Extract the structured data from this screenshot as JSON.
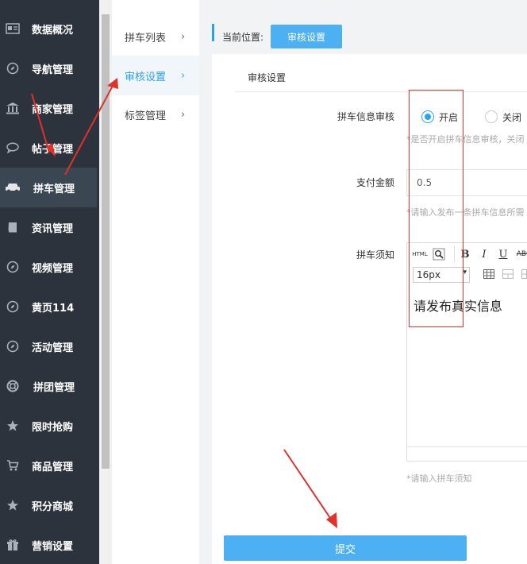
{
  "sidebar": {
    "items": [
      {
        "label": "数据概况",
        "icon": "dashboard-icon"
      },
      {
        "label": "导航管理",
        "icon": "compass-icon"
      },
      {
        "label": "商家管理",
        "icon": "bank-icon"
      },
      {
        "label": "帖子管理",
        "icon": "chat-icon"
      },
      {
        "label": "拼车管理",
        "icon": "car-icon"
      },
      {
        "label": "资讯管理",
        "icon": "book-icon"
      },
      {
        "label": "视频管理",
        "icon": "compass-icon"
      },
      {
        "label": "黄页114",
        "icon": "compass-icon"
      },
      {
        "label": "活动管理",
        "icon": "compass-icon"
      },
      {
        "label": "拼团管理",
        "icon": "lifebuoy-icon"
      },
      {
        "label": "限时抢购",
        "icon": "star-icon"
      },
      {
        "label": "商品管理",
        "icon": "cart-icon"
      },
      {
        "label": "积分商城",
        "icon": "star-icon"
      },
      {
        "label": "营销设置",
        "icon": "gift-icon"
      }
    ],
    "active_index": 4
  },
  "subnav": {
    "items": [
      {
        "label": "拼车列表",
        "chevron": "›"
      },
      {
        "label": "审核设置",
        "chevron": "›"
      },
      {
        "label": "标签管理",
        "chevron": "›"
      }
    ],
    "active_index": 1
  },
  "breadcrumb": {
    "label": "当前位置:",
    "current": "审核设置"
  },
  "panel": {
    "title": "审核设置"
  },
  "form": {
    "review": {
      "label": "拼车信息审核",
      "option_on": "开启",
      "option_off": "关闭",
      "selected": "开启",
      "hint": "*是否开启拼车信息审核，关闭"
    },
    "amount": {
      "label": "支付金额",
      "value": "0.5",
      "hint": "*请输入发布一条拼车信息所需"
    },
    "notice": {
      "label": "拼车须知",
      "toolbar": {
        "html": "HTML",
        "bold": "B",
        "italic": "I",
        "underline": "U",
        "strike": "ABC",
        "font_size": "16px"
      },
      "content": "请发布真实信息",
      "hint": "*请输入拼车须知"
    }
  },
  "submit_label": "提交",
  "colors": {
    "sidebar_bg": "#2c333c",
    "accent": "#2aa3ec",
    "button": "#4cb0f2",
    "annotation": "#e0312b"
  }
}
